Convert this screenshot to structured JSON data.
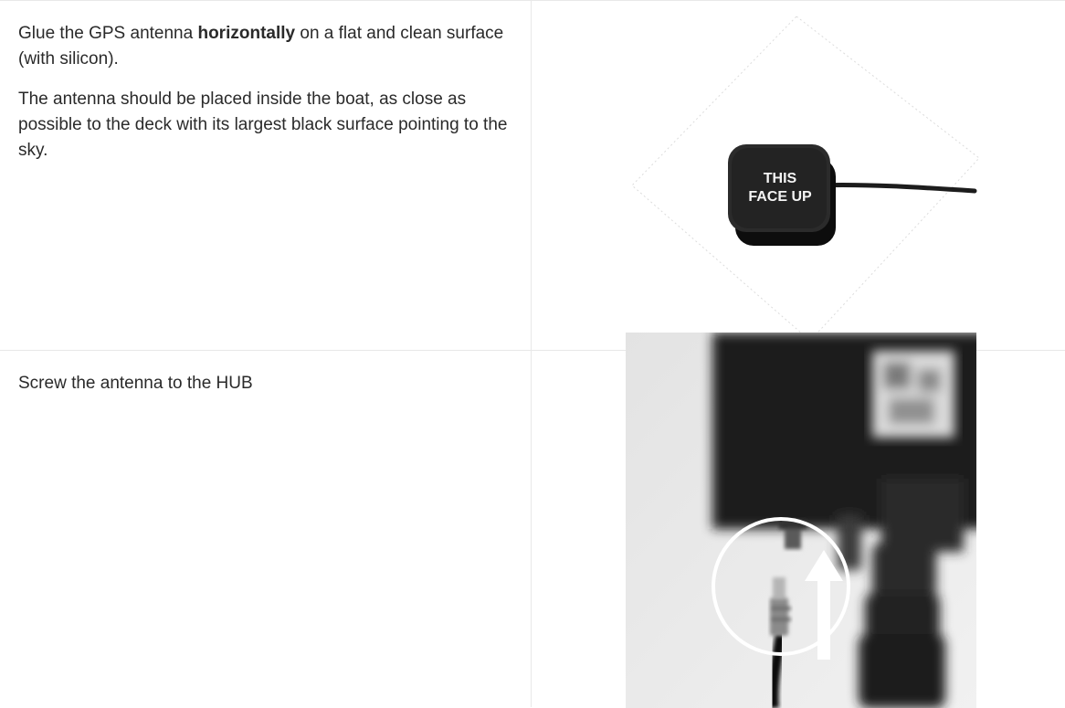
{
  "step1": {
    "text_a_pre": "Glue the GPS antenna ",
    "text_a_bold": "horizontally",
    "text_a_post": " on a flat and clean surface (with silicon).",
    "text_b": "The antenna should be placed inside the boat, as close as possible to the deck with its largest black surface pointing to the sky.",
    "antenna_label_line1": "THIS",
    "antenna_label_line2": "FACE UP"
  },
  "step2": {
    "text": "Screw the antenna to the HUB"
  }
}
